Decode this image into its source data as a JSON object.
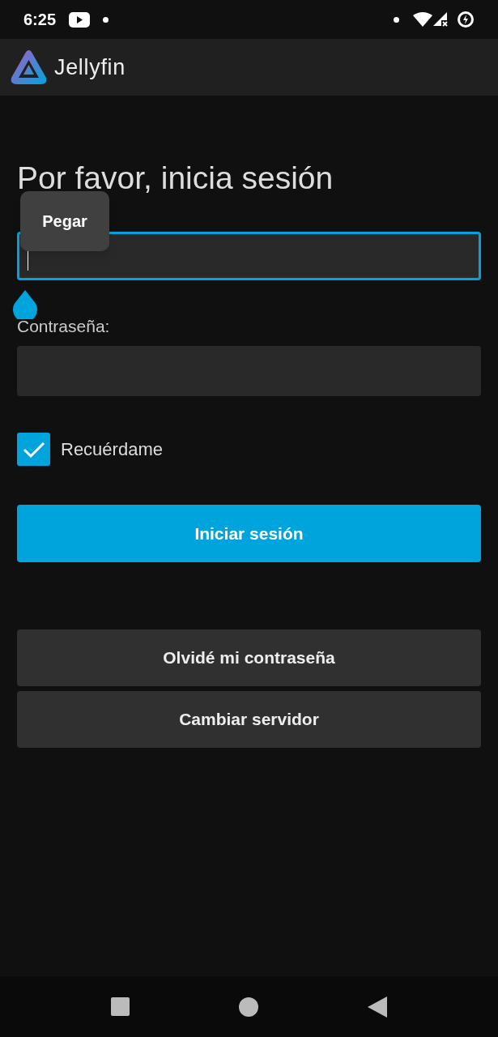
{
  "status_bar": {
    "time": "6:25"
  },
  "app_bar": {
    "title": "Jellyfin"
  },
  "login": {
    "heading": "Por favor, inicia sesión",
    "username_field": {
      "focused": true
    },
    "paste_menu": {
      "label": "Pegar"
    },
    "password": {
      "label": "Contraseña:"
    },
    "remember": {
      "label": "Recuérdame",
      "checked": true
    },
    "primary_button": "Iniciar sesión",
    "secondary_buttons": [
      "Olvidé mi contraseña",
      "Cambiar servidor"
    ]
  }
}
